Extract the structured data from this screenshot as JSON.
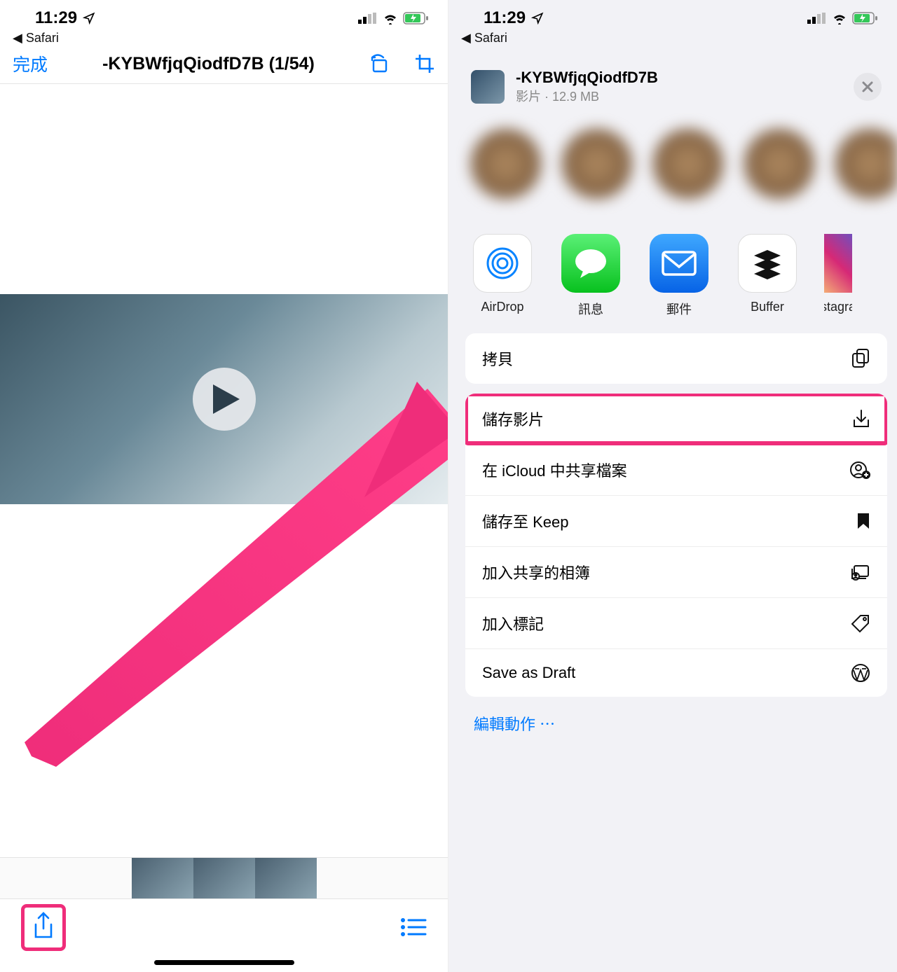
{
  "status": {
    "time": "11:29",
    "back_app": "Safari"
  },
  "left": {
    "done": "完成",
    "title": "-KYBWfjqQiodfD7B (1/54)"
  },
  "right": {
    "file_name": "-KYBWfjqQiodfD7B",
    "file_meta": "影片 · 12.9 MB",
    "apps": [
      {
        "label": "AirDrop",
        "bg": "#ffffff"
      },
      {
        "label": "訊息",
        "bg": "#34c759"
      },
      {
        "label": "郵件",
        "bg": "#1f8efa"
      },
      {
        "label": "Buffer",
        "bg": "#ffffff"
      },
      {
        "label": "Instagram",
        "bg": "linear"
      }
    ],
    "actions_a": [
      {
        "label": "拷貝",
        "icon": "copy"
      }
    ],
    "actions_b": [
      {
        "label": "儲存影片",
        "icon": "download",
        "highlight": true
      },
      {
        "label": "在 iCloud 中共享檔案",
        "icon": "person-add"
      },
      {
        "label": "儲存至 Keep",
        "icon": "bookmark"
      },
      {
        "label": "加入共享的相簿",
        "icon": "shared-album"
      },
      {
        "label": "加入標記",
        "icon": "tag"
      },
      {
        "label": "Save as Draft",
        "icon": "wordpress"
      }
    ],
    "edit_actions": "編輯動作 ⋯"
  },
  "colors": {
    "accent": "#007aff",
    "highlight": "#ef2d7a"
  }
}
